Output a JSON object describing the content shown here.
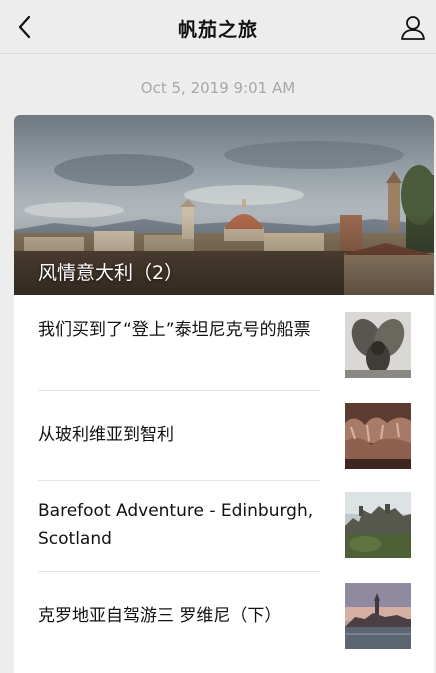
{
  "nav": {
    "title": "帆茄之旅",
    "back_icon": "chevron-left-icon",
    "profile_icon": "person-icon"
  },
  "timestamp": "Oct 5, 2019 9:01 AM",
  "cover": {
    "title": "风情意大利（2）",
    "image": "florence-skyline"
  },
  "articles": [
    {
      "title": "我们买到了“登上”泰坦尼克号的船票",
      "thumb": "ship-propellers"
    },
    {
      "title": "从玻利维亚到智利",
      "thumb": "rock-formation"
    },
    {
      "title": "Barefoot Adventure -  Edinburgh, Scotland",
      "thumb": "edinburgh-castle"
    },
    {
      "title": "克罗地亚自驾游三  罗维尼（下）",
      "thumb": "rovinj-harbor"
    }
  ],
  "colors": {
    "background": "#ededed",
    "card": "#ffffff",
    "timestamp": "#a8a8a8"
  }
}
